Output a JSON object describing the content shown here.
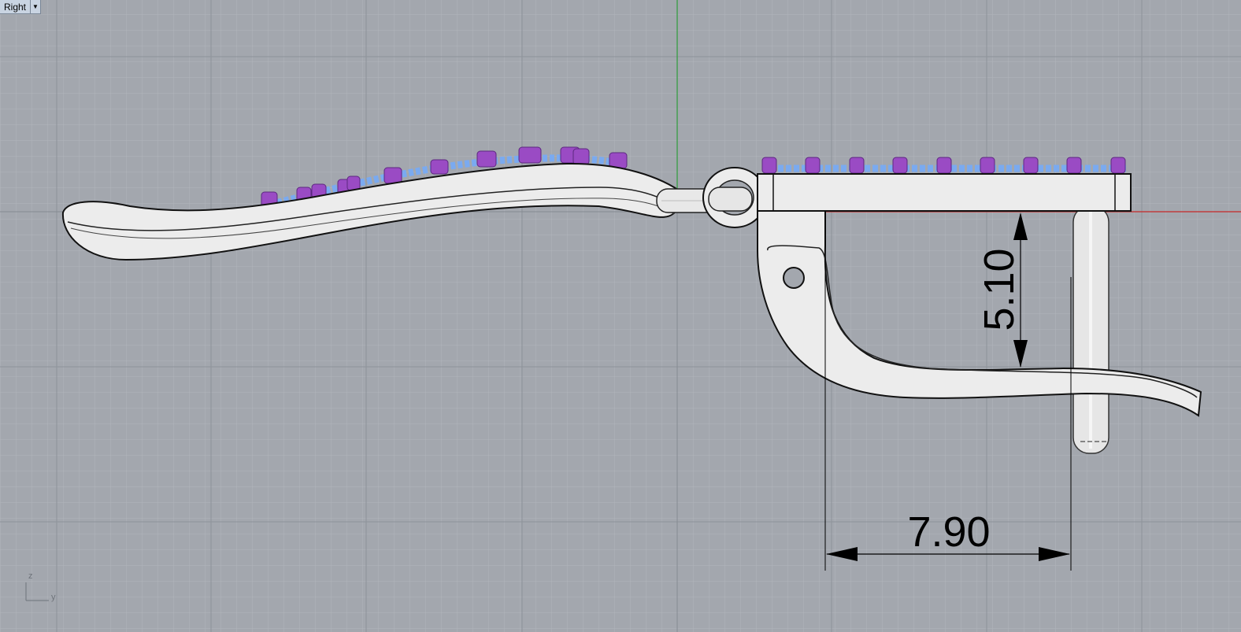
{
  "viewport": {
    "name": "Right",
    "menu_icon": "chevron-down-icon"
  },
  "dimensions": {
    "vertical": "5.10",
    "horizontal": "7.90"
  },
  "axis_icon": {
    "up_label": "z",
    "right_label": "y"
  },
  "colors": {
    "background": "#a3a7ae",
    "grid_minor": "#b3b7be",
    "grid_major": "#8f949b",
    "x_axis": "#c62828",
    "z_axis": "#2e9c3a",
    "metal": "#ececec",
    "stone": "#9a4bc4",
    "setting": "#7aaaf0",
    "dimension": "#000000"
  }
}
